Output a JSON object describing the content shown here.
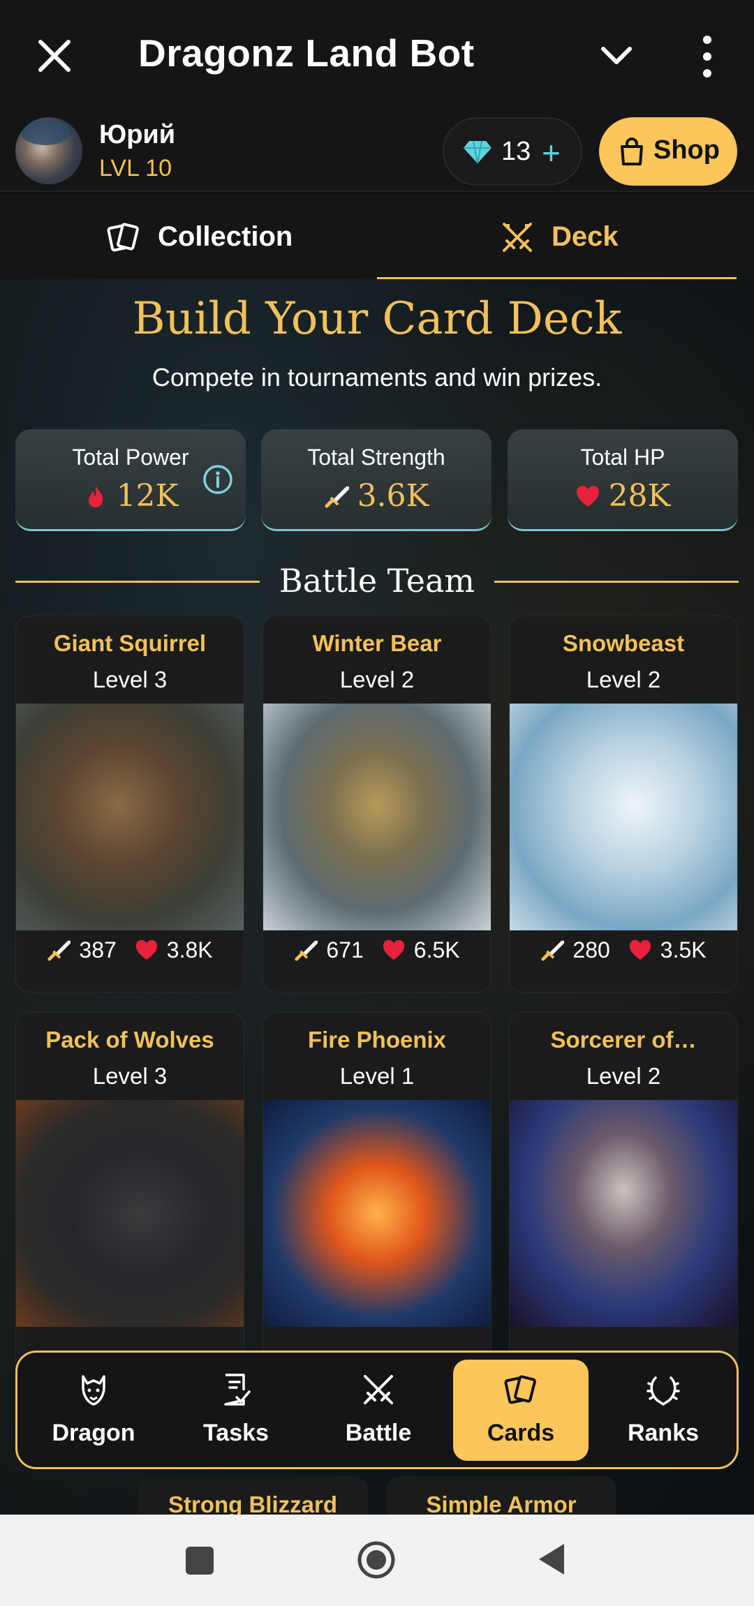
{
  "topbar": {
    "title": "Dragonz Land Bot"
  },
  "profile": {
    "name": "Юрий",
    "level": "LVL 10",
    "gems": "13",
    "shop_label": "Shop"
  },
  "tabs": [
    {
      "label": "Collection",
      "active": false
    },
    {
      "label": "Deck",
      "active": true
    }
  ],
  "deck": {
    "heading": "Build Your Card Deck",
    "subheading": "Compete in tournaments and win prizes.",
    "stats": [
      {
        "label": "Total Power",
        "value": "12K",
        "icon": "flame-icon"
      },
      {
        "label": "Total Strength",
        "value": "3.6K",
        "icon": "sword-icon"
      },
      {
        "label": "Total HP",
        "value": "28K",
        "icon": "heart-icon"
      }
    ],
    "team_title": "Battle Team",
    "cards": [
      {
        "name": "Giant Squirrel",
        "level": "Level 3",
        "strength": "387",
        "hp": "3.8K"
      },
      {
        "name": "Winter Bear",
        "level": "Level 2",
        "strength": "671",
        "hp": "6.5K"
      },
      {
        "name": "Snowbeast",
        "level": "Level 2",
        "strength": "280",
        "hp": "3.5K"
      },
      {
        "name": "Pack of Wolves",
        "level": "Level 3"
      },
      {
        "name": "Fire Phoenix",
        "level": "Level 1"
      },
      {
        "name": "Sorcerer of…",
        "level": "Level 2"
      }
    ],
    "peek_cards": [
      {
        "name": "Strong Blizzard"
      },
      {
        "name": "Simple Armor"
      }
    ]
  },
  "bottom_nav": [
    {
      "label": "Dragon",
      "icon": "dragon-icon",
      "active": false
    },
    {
      "label": "Tasks",
      "icon": "tasks-icon",
      "active": false
    },
    {
      "label": "Battle",
      "icon": "swords-icon",
      "active": false
    },
    {
      "label": "Cards",
      "icon": "cards-icon",
      "active": true
    },
    {
      "label": "Ranks",
      "icon": "laurel-icon",
      "active": false
    }
  ],
  "colors": {
    "accent": "#f2c15b",
    "button": "#fcc65a",
    "gem": "#5fd3e0",
    "heart": "#e8223a"
  }
}
